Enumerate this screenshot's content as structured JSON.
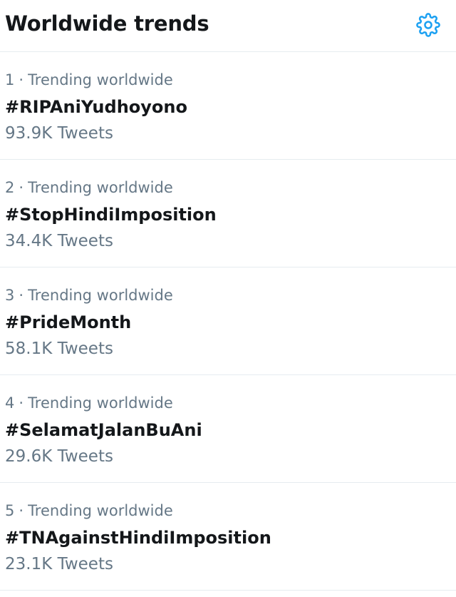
{
  "header": {
    "title": "Worldwide trends",
    "settings_icon": "gear-icon"
  },
  "colors": {
    "accent": "#1da1f2",
    "muted_text": "#657786",
    "primary_text": "#14171a",
    "divider": "#e6ecf0"
  },
  "trends": [
    {
      "rank": "1",
      "context": "Trending worldwide",
      "name": "#RIPAniYudhoyono",
      "count": "93.9K Tweets"
    },
    {
      "rank": "2",
      "context": "Trending worldwide",
      "name": "#StopHindiImposition",
      "count": "34.4K Tweets"
    },
    {
      "rank": "3",
      "context": "Trending worldwide",
      "name": "#PrideMonth",
      "count": "58.1K Tweets"
    },
    {
      "rank": "4",
      "context": "Trending worldwide",
      "name": "#SelamatJalanBuAni",
      "count": "29.6K Tweets"
    },
    {
      "rank": "5",
      "context": "Trending worldwide",
      "name": "#TNAgainstHindiImposition",
      "count": "23.1K Tweets"
    }
  ]
}
